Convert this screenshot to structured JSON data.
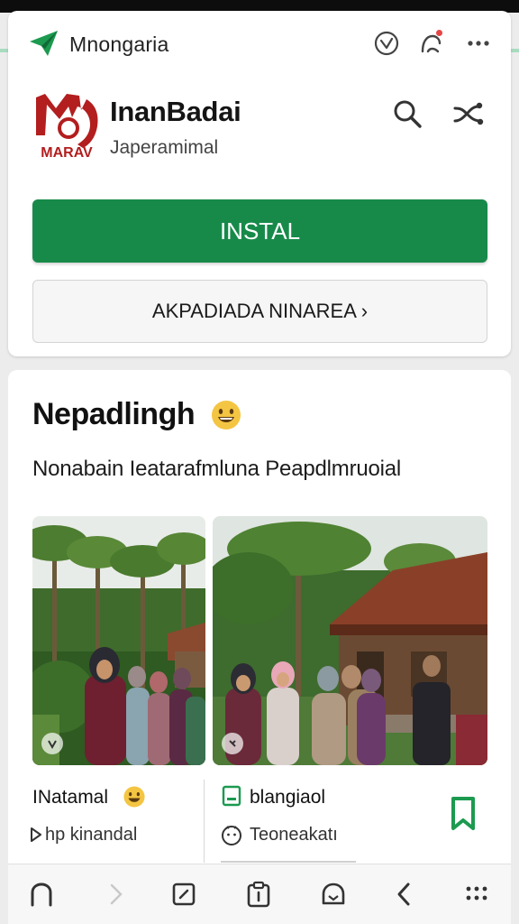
{
  "header": {
    "brand_name": "Mnongaria"
  },
  "app": {
    "title": "InanBadai",
    "subtitle": "Japeramimal",
    "logo_text": "MARAV",
    "install_label": "INSTAL",
    "secondary_label": "AKPADIADA NINAREA ›"
  },
  "section": {
    "title": "Nepadlingh",
    "description": "Nonabain Ieatarafmluna Peapdlmruoial"
  },
  "gallery": {
    "items": [
      {
        "meta": {
          "title": "INatamal",
          "subtitle": "hp kinandal"
        }
      },
      {
        "meta": {
          "title": "blangiaol",
          "subtitle": "Teoneakatı"
        }
      }
    ]
  },
  "icons": {
    "brand": "paper-plane-icon",
    "appbar": [
      "check-circle-icon",
      "notification-bell-icon",
      "more-horizontal-icon"
    ],
    "actions": [
      "search-icon",
      "shuffle-icon"
    ],
    "nav": [
      "home-icon",
      "forward-icon",
      "edit-square-icon",
      "clipboard-icon",
      "assistant-icon",
      "back-icon",
      "apps-grid-icon"
    ]
  },
  "colors": {
    "brand_green": "#178a4a",
    "logo_red": "#b31e1e",
    "notification_dot": "#e64545",
    "bookmark_green": "#1c9a50"
  }
}
